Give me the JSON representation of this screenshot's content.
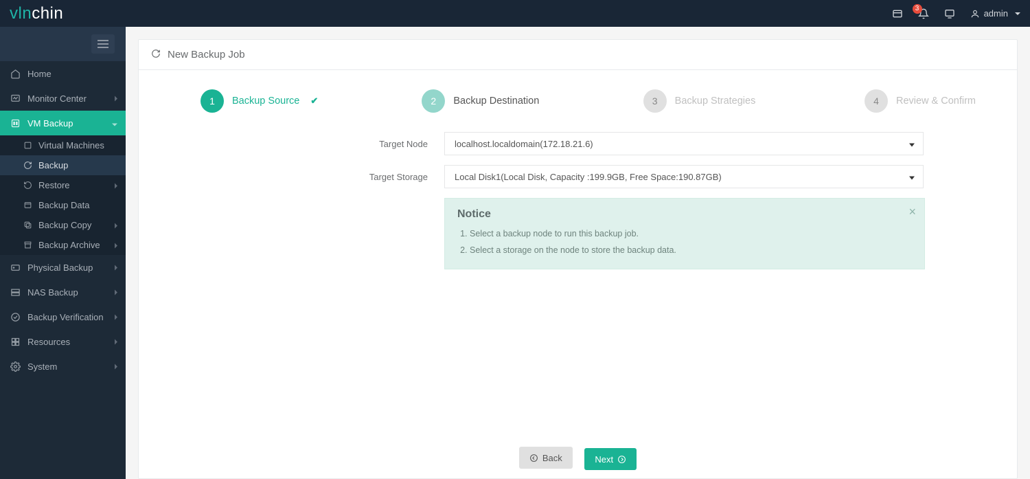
{
  "header": {
    "logo": {
      "pre": "vln",
      "post": "chin"
    },
    "badge_count": "3",
    "username": "admin"
  },
  "sidebar": {
    "items": [
      {
        "label": "Home"
      },
      {
        "label": "Monitor Center"
      },
      {
        "label": "VM Backup"
      },
      {
        "label": "Physical Backup"
      },
      {
        "label": "NAS Backup"
      },
      {
        "label": "Backup Verification"
      },
      {
        "label": "Resources"
      },
      {
        "label": "System"
      }
    ],
    "vm_submenu": [
      {
        "label": "Virtual Machines"
      },
      {
        "label": "Backup"
      },
      {
        "label": "Restore"
      },
      {
        "label": "Backup Data"
      },
      {
        "label": "Backup Copy"
      },
      {
        "label": "Backup Archive"
      }
    ]
  },
  "page": {
    "title": "New Backup Job"
  },
  "steps": [
    {
      "num": "1",
      "label": "Backup Source"
    },
    {
      "num": "2",
      "label": "Backup Destination"
    },
    {
      "num": "3",
      "label": "Backup Strategies"
    },
    {
      "num": "4",
      "label": "Review & Confirm"
    }
  ],
  "form": {
    "target_node": {
      "label": "Target Node",
      "value": "localhost.localdomain(172.18.21.6)"
    },
    "target_storage": {
      "label": "Target Storage",
      "value": "Local Disk1(Local Disk, Capacity :199.9GB, Free Space:190.87GB)"
    }
  },
  "notice": {
    "title": "Notice",
    "items": [
      "Select a backup node to run this backup job.",
      "Select a storage on the node to store the backup data."
    ]
  },
  "buttons": {
    "back": "Back",
    "next": "Next"
  }
}
